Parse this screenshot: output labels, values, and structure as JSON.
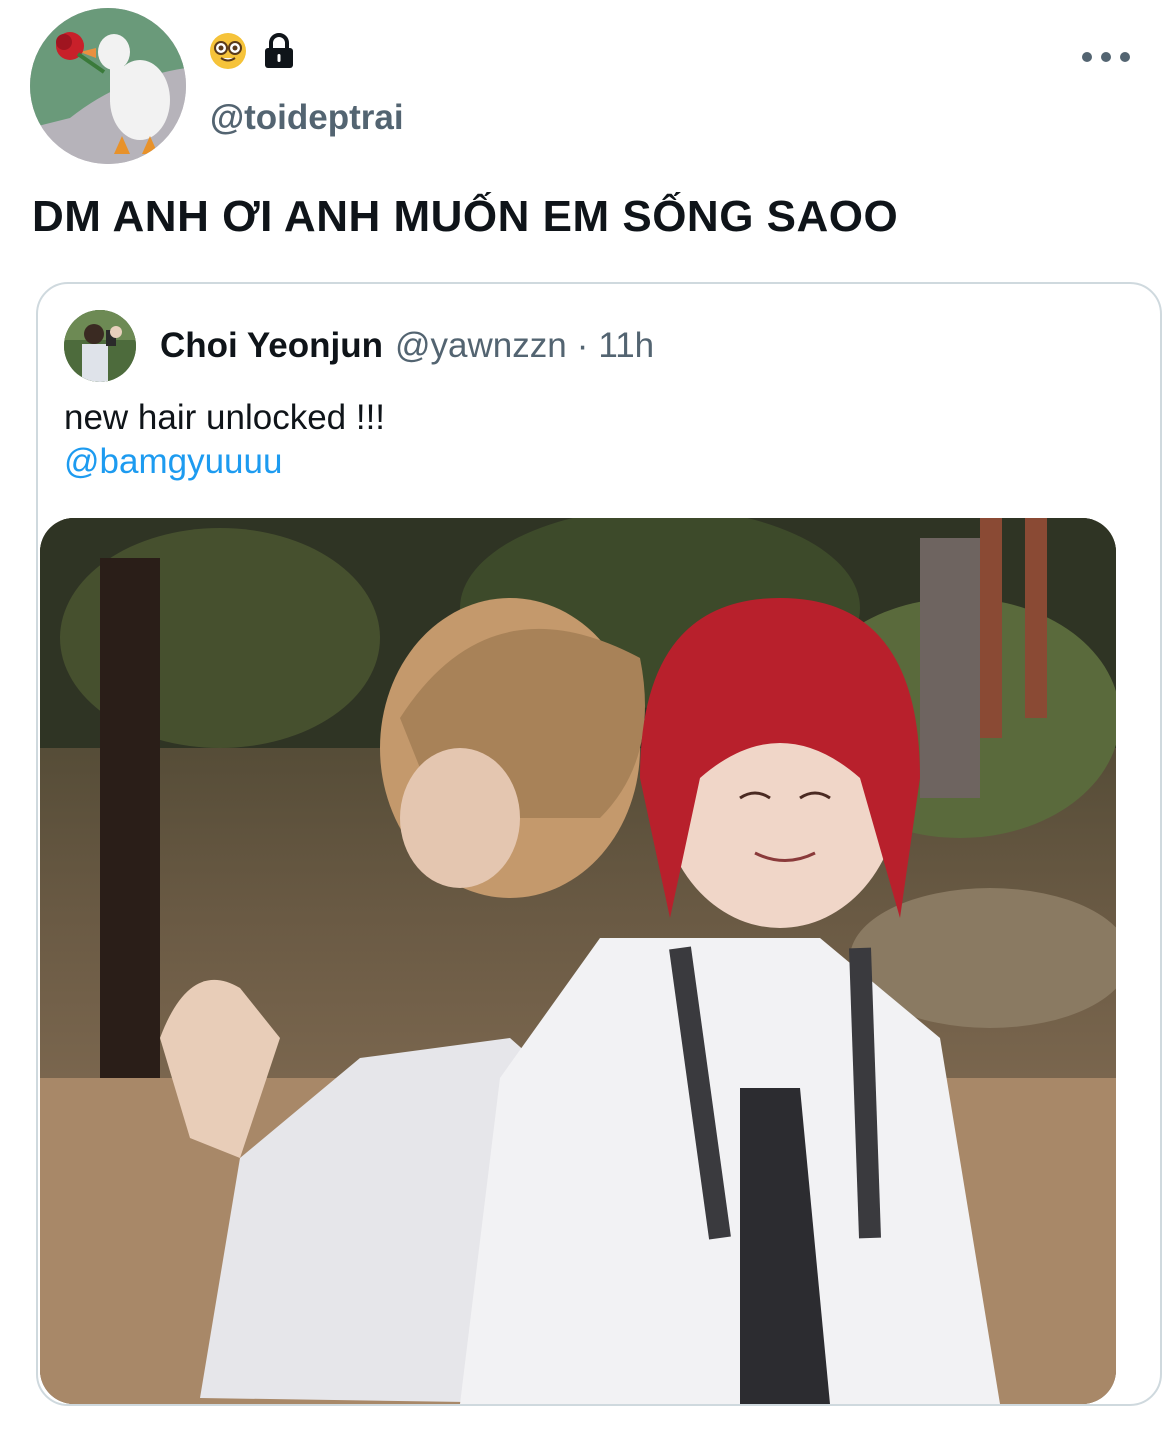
{
  "tweet": {
    "author": {
      "handle": "@toideptrai",
      "avatar_icon": "goose-with-rose-avatar",
      "badges": [
        "nerd-face-emoji",
        "lock-icon"
      ]
    },
    "text": "DM ANH ƠI ANH MUỐN EM SỐNG SAOO",
    "more_icon": "more-horizontal-icon"
  },
  "quoted_tweet": {
    "display_name": "Choi Yeonjun",
    "handle": "@yawnzzn",
    "separator": "·",
    "time": "11h",
    "text": "new hair unlocked !!!",
    "mention": "@bamgyuuuu",
    "media_icon": "photo-two-students"
  },
  "colors": {
    "text_primary": "#0f1419",
    "text_secondary": "#536471",
    "link": "#1d9bf0",
    "border": "#cfd9de"
  }
}
